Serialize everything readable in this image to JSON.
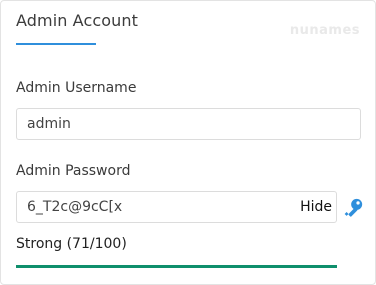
{
  "section": {
    "title": "Admin Account",
    "watermark": "nunames"
  },
  "username": {
    "label": "Admin Username",
    "value": "admin"
  },
  "password": {
    "label": "Admin Password",
    "value": "6_T2c@9cC[x",
    "toggle_label": "Hide",
    "generate_icon": "key-icon"
  },
  "strength": {
    "text": "Strong (71/100)",
    "fill": 1.0,
    "color": "#0f8f6c"
  },
  "colors": {
    "accent": "#2f8fdc",
    "strong": "#0f8f6c"
  }
}
